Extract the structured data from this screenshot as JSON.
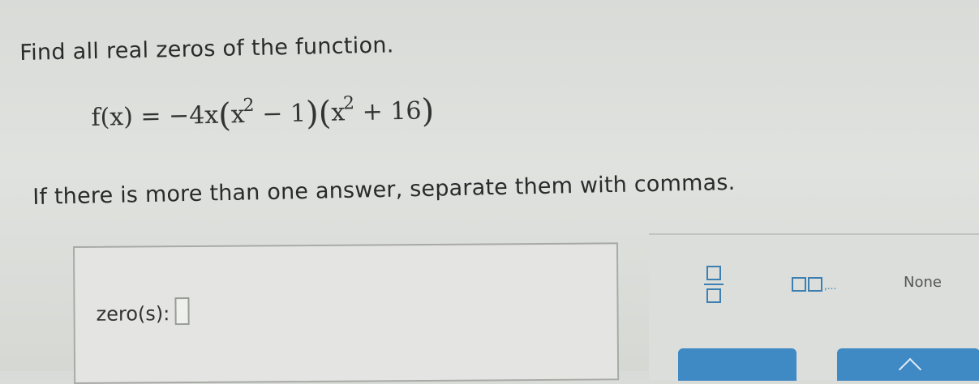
{
  "question": {
    "prompt": "Find all real zeros of the function.",
    "equation": {
      "lhs": "f(x) = −4x",
      "factor1_base": "x",
      "factor1_exp": "2",
      "factor1_rest": " − 1",
      "factor2_base": "x",
      "factor2_exp": "2",
      "factor2_rest": " + 16"
    },
    "instruction": "If there is more than one answer, separate them with commas."
  },
  "answer": {
    "label": "zero(s):",
    "value": ""
  },
  "palette": {
    "fraction_tool": "fraction-template",
    "list_suffix": ",...",
    "none_label": "None"
  },
  "colors": {
    "accent": "#3d7fb0",
    "button": "#3f89c5"
  }
}
